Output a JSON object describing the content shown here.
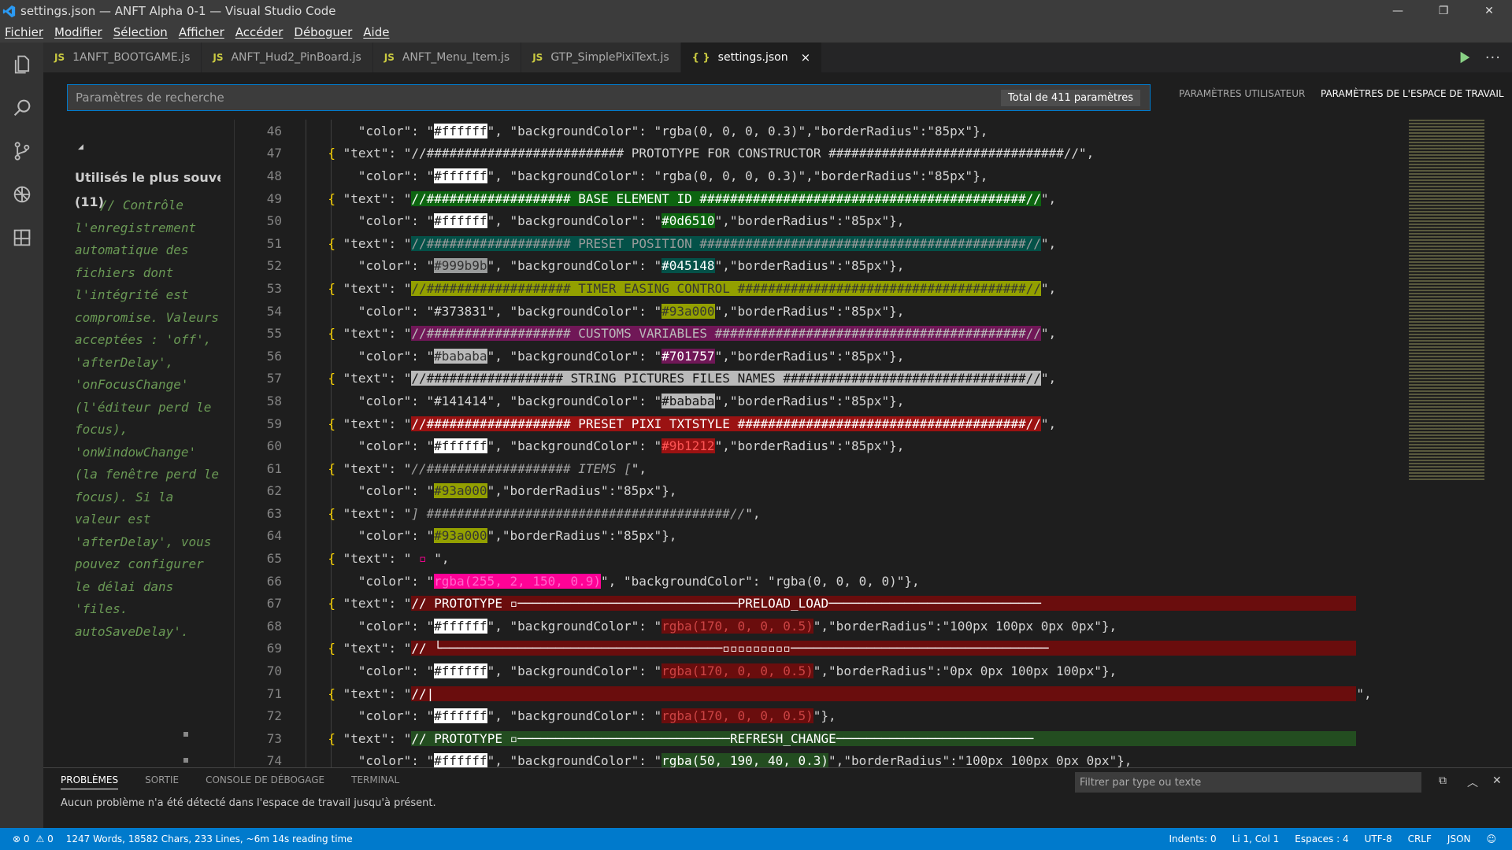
{
  "window": {
    "title": "settings.json — ANFT Alpha 0-1 — Visual Studio Code",
    "minimize": "—",
    "maximize": "❐",
    "close": "✕"
  },
  "menu": [
    "Fichier",
    "Modifier",
    "Sélection",
    "Afficher",
    "Accéder",
    "Déboguer",
    "Aide"
  ],
  "tabs": [
    {
      "icon": "JS",
      "label": "1ANFT_BOOTGAME.js",
      "active": false
    },
    {
      "icon": "JS",
      "label": "ANFT_Hud2_PinBoard.js",
      "active": false
    },
    {
      "icon": "JS",
      "label": "ANFT_Menu_Item.js",
      "active": false
    },
    {
      "icon": "JS",
      "label": "GTP_SimplePixiText.js",
      "active": false
    },
    {
      "icon": "{ }",
      "label": "settings.json",
      "active": true
    }
  ],
  "tab_close": "×",
  "tab_more": "···",
  "search": {
    "placeholder": "Paramètres de recherche",
    "count": "Total de 411 paramètres"
  },
  "scopes": {
    "user": "PARAMÈTRES UTILISATEUR",
    "workspace": "PARAMÈTRES DE L'ESPACE DE TRAVAIL"
  },
  "left_panel": {
    "collapse": "◢",
    "title": "Utilisés le plus souvent",
    "count": "(11)",
    "description": "// Contrôle l'enregistrement automatique des fichiers dont l'intégrité est compromise. Valeurs acceptées : 'off', 'afterDelay', 'onFocusChange' (l'éditeur perd le focus), 'onWindowChange' (la fenêtre perd le focus). Si la valeur est 'afterDelay', vous pouvez configurer le délai dans 'files. autoSaveDelay'."
  },
  "code_lines": [
    {
      "n": "46",
      "indent": 8,
      "parts": [
        [
          "p",
          "\"color\": \""
        ],
        [
          "w",
          "#ffffff"
        ],
        [
          "p",
          "\", \"backgroundColor\": \"rgba(0, 0, 0, 0.3)\",\"borderRadius\":\"85px\"},"
        ]
      ]
    },
    {
      "n": "47",
      "indent": 4,
      "parts": [
        [
          "b",
          "{ "
        ],
        [
          "p",
          "\"text\": \"//########################## PROTOTYPE FOR CONSTRUCTOR ###############################//\","
        ]
      ]
    },
    {
      "n": "48",
      "indent": 8,
      "parts": [
        [
          "p",
          "\"color\": \""
        ],
        [
          "w",
          "#ffffff"
        ],
        [
          "p",
          "\", \"backgroundColor\": \"rgba(0, 0, 0, 0.3)\",\"borderRadius\":\"85px\"},"
        ]
      ]
    },
    {
      "n": "49",
      "indent": 4,
      "parts": [
        [
          "b",
          "{ "
        ],
        [
          "p",
          "\"text\": \""
        ],
        [
          "g",
          "//################### BASE ELEMENT ID ###########################################//"
        ],
        [
          "p",
          "\","
        ]
      ]
    },
    {
      "n": "50",
      "indent": 8,
      "parts": [
        [
          "p",
          "\"color\": \""
        ],
        [
          "w",
          "#ffffff"
        ],
        [
          "p",
          "\", \"backgroundColor\": \""
        ],
        [
          "g2",
          "#0d6510"
        ],
        [
          "p",
          "\",\"borderRadius\":\"85px\"},"
        ]
      ]
    },
    {
      "n": "51",
      "indent": 4,
      "parts": [
        [
          "b",
          "{ "
        ],
        [
          "p",
          "\"text\": \""
        ],
        [
          "t",
          "//################### PRESET POSITION ###########################################//"
        ],
        [
          "p",
          "\","
        ]
      ]
    },
    {
      "n": "52",
      "indent": 8,
      "parts": [
        [
          "p",
          "\"color\": \""
        ],
        [
          "gr",
          "#999b9b"
        ],
        [
          "p",
          "\", \"backgroundColor\": \""
        ],
        [
          "t2",
          "#045148"
        ],
        [
          "p",
          "\",\"borderRadius\":\"85px\"},"
        ]
      ]
    },
    {
      "n": "53",
      "indent": 4,
      "parts": [
        [
          "b",
          "{ "
        ],
        [
          "p",
          "\"text\": \""
        ],
        [
          "y",
          "//################### TIMER EASING CONTROL ######################################//"
        ],
        [
          "p",
          "\","
        ]
      ]
    },
    {
      "n": "54",
      "indent": 8,
      "parts": [
        [
          "p",
          "\"color\": \"#373831\", \"backgroundColor\": \""
        ],
        [
          "y2",
          "#93a000"
        ],
        [
          "p",
          "\",\"borderRadius\":\"85px\"},"
        ]
      ]
    },
    {
      "n": "55",
      "indent": 4,
      "parts": [
        [
          "b",
          "{ "
        ],
        [
          "p",
          "\"text\": \""
        ],
        [
          "m",
          "//################### CUSTOMS VARIABLES #########################################//"
        ],
        [
          "p",
          "\","
        ]
      ]
    },
    {
      "n": "56",
      "indent": 8,
      "parts": [
        [
          "p",
          "\"color\": \""
        ],
        [
          "gr2",
          "#bababa"
        ],
        [
          "p",
          "\", \"backgroundColor\": \""
        ],
        [
          "m2",
          "#701757"
        ],
        [
          "p",
          "\",\"borderRadius\":\"85px\"},"
        ]
      ]
    },
    {
      "n": "57",
      "indent": 4,
      "parts": [
        [
          "b",
          "{ "
        ],
        [
          "p",
          "\"text\": \""
        ],
        [
          "lg",
          "//################## STRING PICTURES FILES NAMES ################################//"
        ],
        [
          "p",
          "\","
        ]
      ]
    },
    {
      "n": "58",
      "indent": 8,
      "parts": [
        [
          "p",
          "\"color\": \"#141414\", \"backgroundColor\": \""
        ],
        [
          "lg2",
          "#bababa"
        ],
        [
          "p",
          "\",\"borderRadius\":\"85px\"},"
        ]
      ]
    },
    {
      "n": "59",
      "indent": 4,
      "parts": [
        [
          "b",
          "{ "
        ],
        [
          "p",
          "\"text\": \""
        ],
        [
          "r",
          "//################### PRESET PIXI TXTSTYLE ######################################//"
        ],
        [
          "p",
          "\","
        ]
      ]
    },
    {
      "n": "60",
      "indent": 8,
      "parts": [
        [
          "p",
          "\"color\": \""
        ],
        [
          "w",
          "#ffffff"
        ],
        [
          "p",
          "\", \"backgroundColor\": \""
        ],
        [
          "r2",
          "#9b1212"
        ],
        [
          "p",
          "\",\"borderRadius\":\"85px\"},"
        ]
      ]
    },
    {
      "n": "61",
      "indent": 4,
      "parts": [
        [
          "b",
          "{ "
        ],
        [
          "p",
          "\"text\": \""
        ],
        [
          "ital",
          "//################### ITEMS ["
        ],
        [
          "p",
          "\","
        ]
      ]
    },
    {
      "n": "62",
      "indent": 8,
      "parts": [
        [
          "p",
          "\"color\": \""
        ],
        [
          "y2",
          "#93a000"
        ],
        [
          "p",
          "\",\"borderRadius\":\"85px\"},"
        ]
      ]
    },
    {
      "n": "63",
      "indent": 4,
      "parts": [
        [
          "b",
          "{ "
        ],
        [
          "p",
          "\"text\": \""
        ],
        [
          "ital",
          "] ########################################//"
        ],
        [
          "p",
          "\","
        ]
      ]
    },
    {
      "n": "64",
      "indent": 8,
      "parts": [
        [
          "p",
          "\"color\": \""
        ],
        [
          "y2",
          "#93a000"
        ],
        [
          "p",
          "\",\"borderRadius\":\"85px\"},"
        ]
      ]
    },
    {
      "n": "65",
      "indent": 4,
      "parts": [
        [
          "b",
          "{ "
        ],
        [
          "p",
          "\"text\": \" "
        ],
        [
          "pk",
          "▫"
        ],
        [
          "p",
          " \","
        ]
      ]
    },
    {
      "n": "66",
      "indent": 8,
      "parts": [
        [
          "p",
          "\"color\": \""
        ],
        [
          "pk2",
          "rgba(255, 2, 150, 0.9)"
        ],
        [
          "p",
          "\", \"backgroundColor\": \"rgba(0, 0, 0, 0)\"},"
        ]
      ]
    },
    {
      "n": "67",
      "indent": 4,
      "parts": [
        [
          "b",
          "{ "
        ],
        [
          "p",
          "\"text\": \""
        ],
        [
          "dr",
          "// PROTOTYPE ▫─────────────────────────────PRELOAD_LOAD────────────────────────────"
        ]
      ]
    },
    {
      "n": "68",
      "indent": 8,
      "parts": [
        [
          "p",
          "\"color\": \""
        ],
        [
          "w",
          "#ffffff"
        ],
        [
          "p",
          "\", \"backgroundColor\": \""
        ],
        [
          "dr2",
          "rgba(170, 0, 0, 0.5)"
        ],
        [
          "p",
          "\",\"borderRadius\":\"100px 100px 0px 0px\"},"
        ]
      ]
    },
    {
      "n": "69",
      "indent": 4,
      "parts": [
        [
          "b",
          "{ "
        ],
        [
          "p",
          "\"text\": \""
        ],
        [
          "dr",
          "// └─────────────────────────────────────▫▫▫▫▫▫▫▫▫──────────────────────────────────"
        ]
      ]
    },
    {
      "n": "70",
      "indent": 8,
      "parts": [
        [
          "p",
          "\"color\": \""
        ],
        [
          "w",
          "#ffffff"
        ],
        [
          "p",
          "\", \"backgroundColor\": \""
        ],
        [
          "dr2",
          "rgba(170, 0, 0, 0.5)"
        ],
        [
          "p",
          "\",\"borderRadius\":\"0px 0px 100px 100px\"},"
        ]
      ]
    },
    {
      "n": "71",
      "indent": 4,
      "parts": [
        [
          "b",
          "{ "
        ],
        [
          "p",
          "\"text\": \""
        ],
        [
          "dr",
          "//|"
        ],
        [
          "p",
          "\","
        ]
      ]
    },
    {
      "n": "72",
      "indent": 8,
      "parts": [
        [
          "p",
          "\"color\": \""
        ],
        [
          "w",
          "#ffffff"
        ],
        [
          "p",
          "\", \"backgroundColor\": \""
        ],
        [
          "dr2",
          "rgba(170, 0, 0, 0.5)"
        ],
        [
          "p",
          "\"},"
        ]
      ]
    },
    {
      "n": "73",
      "indent": 4,
      "parts": [
        [
          "b",
          "{ "
        ],
        [
          "p",
          "\"text\": \""
        ],
        [
          "dg",
          "// PROTOTYPE ▫────────────────────────────REFRESH_CHANGE──────────────────────────"
        ]
      ]
    },
    {
      "n": "74",
      "indent": 8,
      "parts": [
        [
          "p",
          "\"color\": \""
        ],
        [
          "w",
          "#ffffff"
        ],
        [
          "p",
          "\", \"backgroundColor\": \""
        ],
        [
          "dg2",
          "rgba(50, 190, 40, 0.3)"
        ],
        [
          "p",
          "\",\"borderRadius\":\"100px 100px 0px 0px\"},"
        ]
      ]
    }
  ],
  "panel": {
    "tabs": [
      "PROBLÈMES",
      "SORTIE",
      "CONSOLE DE DÉBOGAGE",
      "TERMINAL"
    ],
    "filter_placeholder": "Filtrer par type ou texte",
    "message": "Aucun problème n'a été détecté dans l'espace de travail jusqu'à présent.",
    "copy": "⧉",
    "up": "︿",
    "close": "✕"
  },
  "status": {
    "errors": "⊗ 0",
    "warnings": "⚠ 0",
    "stats": "1247 Words, 18582 Chars, 233 Lines, ~6m 14s reading time",
    "indents": "Indents: 0",
    "position": "Li 1, Col 1",
    "spaces": "Espaces : 4",
    "encoding": "UTF-8",
    "eol": "CRLF",
    "language": "JSON",
    "feedback": "☺"
  },
  "colors": {
    "accent": "#007acc",
    "status_bar": "#007acc",
    "activity_bar": "#333333",
    "editor_bg": "#1e1e1e",
    "run": "#89d185"
  },
  "icons": {
    "explorer": "files-icon",
    "search": "search-icon",
    "scm": "source-control-icon",
    "debug": "debug-icon",
    "extensions": "extensions-icon"
  }
}
